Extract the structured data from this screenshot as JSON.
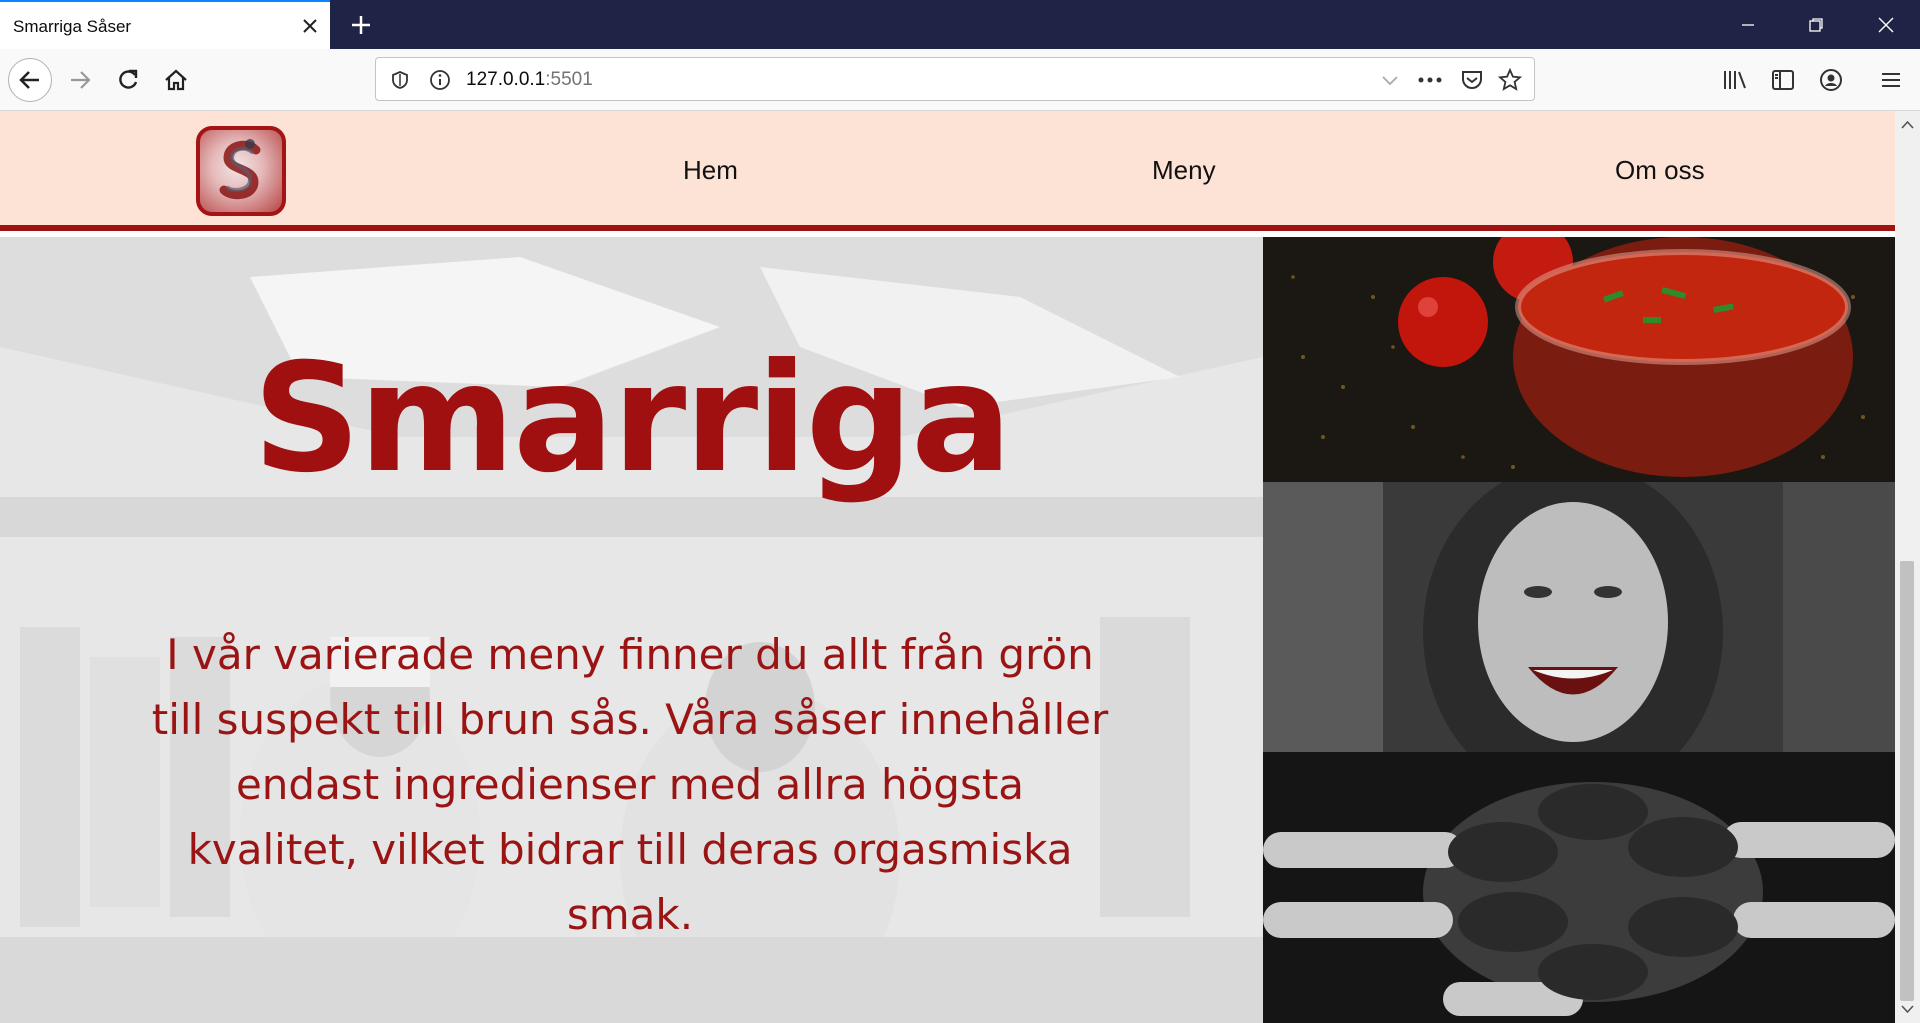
{
  "browser": {
    "tab_title": "Smarriga Såser",
    "url_host": "127.0.0.1",
    "url_port": ":5501"
  },
  "site": {
    "nav": [
      "Hem",
      "Meny",
      "Om oss"
    ],
    "hero_title": "Smarriga",
    "hero_text": "I vår varierade meny finner du allt från grön till suspekt till brun sås. Våra såser innehåller endast ingredienser med allra högsta kvalitet, vilket bidrar till deras orgasmiska smak.",
    "colors": {
      "brand_red": "#a01010",
      "header_bg": "#fde3d6",
      "border_red": "#9e1212"
    },
    "images": [
      "tomato-sauce-jar-photo",
      "smiling-woman-photo",
      "painted-hands-photo"
    ]
  }
}
